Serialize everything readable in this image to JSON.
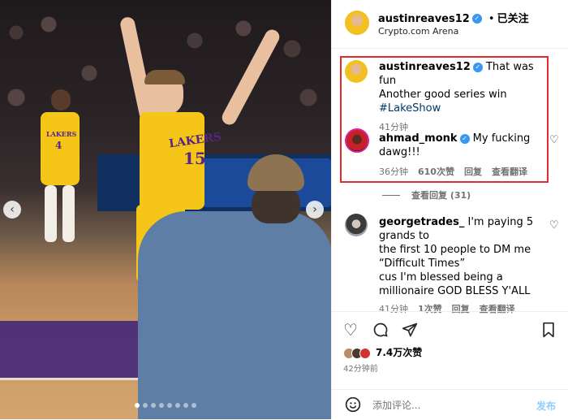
{
  "post": {
    "username": "austinreaves12",
    "follow_status": "已关注",
    "location": "Crypto.com Arena",
    "jersey_brand": "LAKERS",
    "jersey_number": "15",
    "left_jersey_brand": "LAKERS",
    "left_jersey_number": "4"
  },
  "caption": {
    "username": "austinreaves12",
    "text_line1": "That was fun",
    "text_line2": "Another good series win",
    "hashtag": "#LakeShow",
    "time": "41分钟"
  },
  "comments": [
    {
      "username": "ahmad_monk",
      "text_line1": "My fucking",
      "text_line2": "dawg!!!",
      "time": "36分钟",
      "likes": "610次赞",
      "reply": "回复",
      "translate": "查看翻译",
      "view_replies": "查看回复 (31)"
    },
    {
      "username": "georgetrades_",
      "text_line1": "I'm paying 5",
      "text_line2": "grands to",
      "text_line3": "the first 10 people to DM me",
      "text_line4": "“Difficult Times”",
      "text_line5": "cus I'm blessed being a",
      "text_line6": "millionaire GOD BLESS Y'ALL",
      "time": "41分钟",
      "likes": "1次赞",
      "reply": "回复",
      "translate": "查看翻译"
    }
  ],
  "stats": {
    "likes": "7.4万次赞",
    "posted": "42分钟前"
  },
  "comment_input": {
    "placeholder": "添加评论...",
    "post_label": "发布"
  },
  "icons": [
    "heart-icon",
    "comment-icon",
    "share-icon",
    "bookmark-icon",
    "emoji-icon",
    "chevron-left-icon",
    "chevron-right-icon",
    "verified-badge-icon"
  ],
  "colors": {
    "highlight_border": "#e52b2b",
    "verified": "#3897f0",
    "post_button": "#0095f6",
    "lakers_gold": "#f5c518",
    "lakers_purple": "#552583"
  },
  "carousel": {
    "dot_count": 8,
    "active_index": 0
  }
}
